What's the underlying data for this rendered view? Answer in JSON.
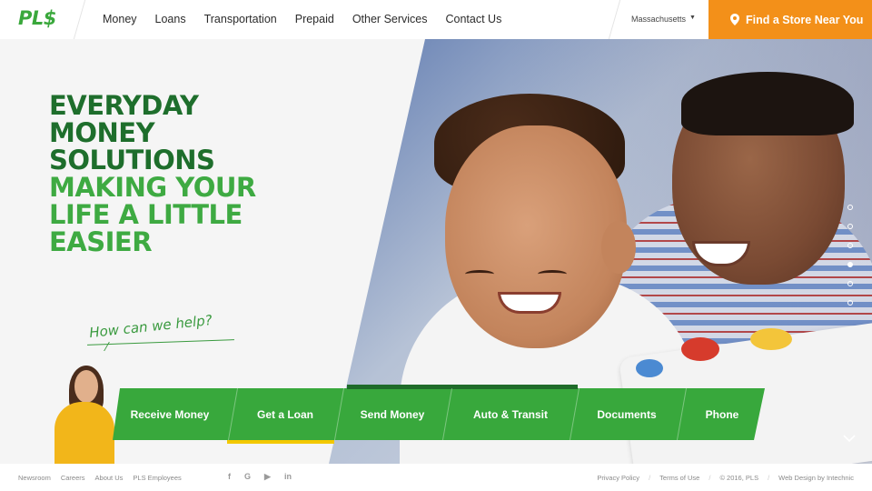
{
  "header": {
    "logo": "PL$",
    "nav": [
      "Money",
      "Loans",
      "Transportation",
      "Prepaid",
      "Other Services",
      "Contact Us"
    ],
    "state": "Massachusetts",
    "store_button": "Find a Store Near You"
  },
  "hero": {
    "headline_dark": [
      "EVERYDAY",
      "MONEY",
      "SOLUTIONS"
    ],
    "headline_light": [
      "MAKING YOUR",
      "LIFE A LITTLE",
      "EASIER"
    ],
    "help_text": "How can we help?",
    "slide_count": 6,
    "active_slide": 4
  },
  "services": [
    "Receive Money",
    "Get a Loan",
    "Send Money",
    "Auto & Transit",
    "Documents",
    "Phone"
  ],
  "footer": {
    "links": [
      "Newsroom",
      "Careers",
      "About Us",
      "PLS Employees"
    ],
    "social": [
      "facebook-icon",
      "google-plus-icon",
      "youtube-icon",
      "linkedin-icon"
    ],
    "privacy": "Privacy Policy",
    "terms": "Terms of Use",
    "copyright": "© 2016, PLS",
    "credit": "Web Design by Intechnic"
  },
  "colors": {
    "green": "#38a83c",
    "dark_green": "#1e6e2c",
    "orange": "#f39019",
    "yellow": "#f3c800"
  }
}
